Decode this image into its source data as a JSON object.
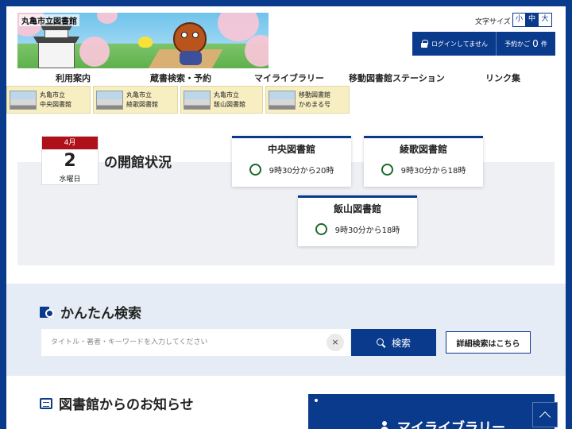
{
  "site": {
    "title": "丸亀市立図書館"
  },
  "font_size": {
    "label": "文字サイズ",
    "options": [
      "小",
      "中",
      "大"
    ],
    "selected": "中"
  },
  "account": {
    "login_label": "ログインしてません",
    "cart_label": "予約かご",
    "cart_count": "0",
    "cart_unit": "件"
  },
  "nav": {
    "items": [
      {
        "label": "利用案内"
      },
      {
        "label": "蔵書検索・予約"
      },
      {
        "label": "マイライブラリー"
      },
      {
        "label": "移動図書館ステーション"
      },
      {
        "label": "リンク集"
      }
    ]
  },
  "branches": [
    {
      "line1": "丸亀市立",
      "line2": "中央図書館"
    },
    {
      "line1": "丸亀市立",
      "line2": "綾歌図書館"
    },
    {
      "line1": "丸亀市立",
      "line2": "飯山図書館"
    },
    {
      "line1": "移動図書館",
      "line2": "かめまる号"
    }
  ],
  "status": {
    "month": "4月",
    "day": "2",
    "weekday": "水曜日",
    "title": "の開館状況",
    "libraries": [
      {
        "name": "中央図書館",
        "hours": "9時30分から20時",
        "state": "open"
      },
      {
        "name": "綾歌図書館",
        "hours": "9時30分から18時",
        "state": "open"
      },
      {
        "name": "飯山図書館",
        "hours": "9時30分から18時",
        "state": "open"
      }
    ]
  },
  "search": {
    "title": "かんたん検索",
    "placeholder": "タイトル・著者・キーワードを入力してください",
    "value": "",
    "clear_label": "×",
    "button_label": "検索",
    "advanced_label": "詳細検索はこちら"
  },
  "news": {
    "title": "図書館からのお知らせ"
  },
  "mylibrary": {
    "label": "マイライブラリー"
  },
  "colors": {
    "brand": "#0a3a8c",
    "date_header": "#b0101a",
    "open_status": "#1b6a2a",
    "branch_bg": "#f7eec2"
  }
}
